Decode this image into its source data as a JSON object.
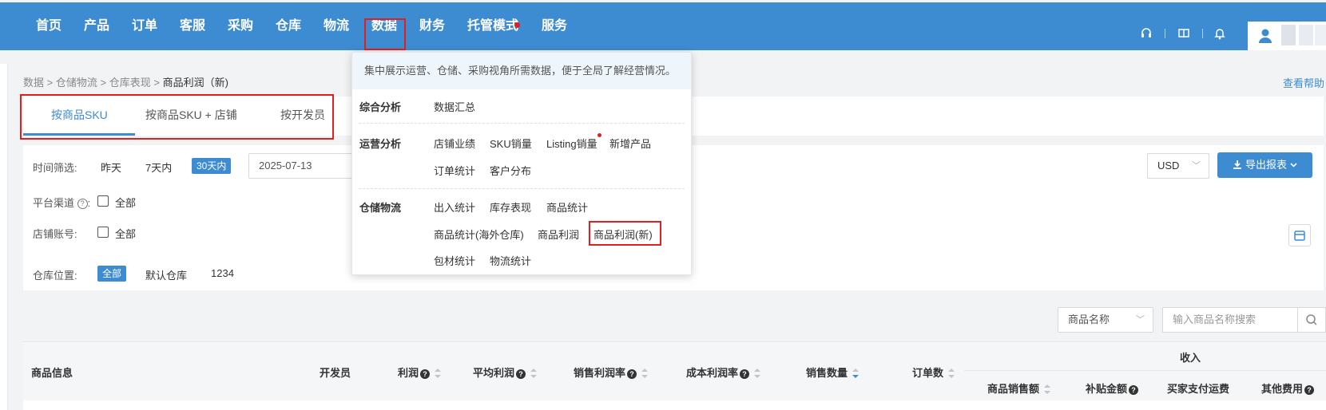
{
  "nav": {
    "items": [
      {
        "label": "首页"
      },
      {
        "label": "产品"
      },
      {
        "label": "订单"
      },
      {
        "label": "客服"
      },
      {
        "label": "采购"
      },
      {
        "label": "仓库"
      },
      {
        "label": "物流"
      },
      {
        "label": "数据"
      },
      {
        "label": "财务"
      },
      {
        "label": "托管模式"
      },
      {
        "label": "服务"
      }
    ],
    "active": "数据",
    "icons": [
      "headset-icon",
      "book-icon",
      "bell-icon",
      "user-icon"
    ]
  },
  "breadcrumb": {
    "items": [
      "数据",
      "仓储物流",
      "仓库表现"
    ],
    "separator": ">",
    "current": "商品利润（新)"
  },
  "help_link": "查看帮助",
  "tabs": [
    {
      "label": "按商品SKU",
      "active": true
    },
    {
      "label": "按商品SKU + 店铺",
      "active": false
    },
    {
      "label": "按开发员",
      "active": false
    }
  ],
  "filters": {
    "time": {
      "label": "时间筛选:",
      "options": [
        "昨天",
        "7天内",
        "30天内"
      ],
      "selected": "30天内",
      "date_value": "2025-07-13"
    },
    "platform": {
      "label": "平台渠道",
      "all_label": "全部"
    },
    "store": {
      "label": "店铺账号:",
      "all_label": "全部"
    },
    "warehouse": {
      "label": "仓库位置:",
      "options": [
        "全部",
        "默认仓库",
        "1234"
      ],
      "selected": "全部"
    },
    "currency": "USD",
    "export_label": "导出报表"
  },
  "search": {
    "field_select": "商品名称",
    "placeholder": "输入商品名称搜索"
  },
  "table": {
    "columns": {
      "product_info": "商品信息",
      "developer": "开发员",
      "profit": "利润",
      "avg_profit": "平均利润",
      "sales_margin": "销售利润率",
      "cost_margin": "成本利润率",
      "sales_qty": "销售数量",
      "order_count": "订单数",
      "income_group": "收入",
      "product_sales": "商品销售额",
      "subsidy": "补贴金额",
      "buyer_shipping": "买家支付运费",
      "other_fees": "其他费用"
    }
  },
  "dropdown": {
    "description": "集中展示运营、仓储、采购视角所需数据，便于全局了解经营情况。",
    "categories": [
      {
        "name": "综合分析",
        "links": [
          "数据汇总"
        ]
      },
      {
        "name": "运营分析",
        "links": [
          "店铺业绩",
          "SKU销量",
          "Listing销量",
          "新增产品",
          "订单统计",
          "客户分布"
        ]
      },
      {
        "name": "仓储物流",
        "links": [
          "出入统计",
          "库存表现",
          "商品统计",
          "商品统计(海外仓库)",
          "商品利润",
          "商品利润(新)",
          "包材统计",
          "物流统计"
        ]
      }
    ],
    "highlighted": "商品利润(新)"
  },
  "colors": {
    "brand": "#3d8bd1",
    "highlight_box": "#e02020",
    "red_dot": "#e02020"
  }
}
